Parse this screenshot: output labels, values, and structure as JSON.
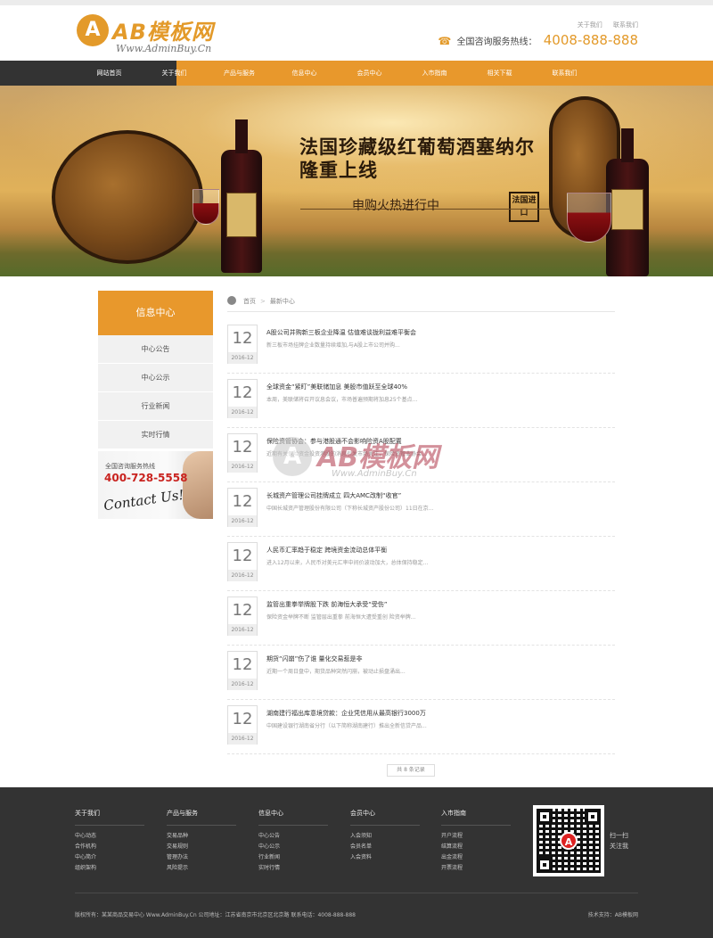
{
  "header": {
    "logo_mark": "A",
    "logo_text": "AB模板网",
    "logo_sub": "Www.AdminBuy.Cn",
    "top_links": [
      "关于我们",
      "联系我们"
    ],
    "hotline_label": "全国咨询服务热线：",
    "hotline_number": "4008-888-888"
  },
  "nav": {
    "items": [
      "网站首页",
      "关于我们",
      "产品与服务",
      "信息中心",
      "会员中心",
      "入市指南",
      "相关下载",
      "联系我们"
    ]
  },
  "banner": {
    "title_line1": "法国珍藏级红葡萄酒塞纳尔",
    "title_line2": "隆重上线",
    "subtitle": "申购火热进行中",
    "stamp": "法国进口"
  },
  "sidebar": {
    "title": "信息中心",
    "items": [
      "中心公告",
      "中心公示",
      "行业新闻",
      "实时行情"
    ],
    "contact_label": "全国咨询服务热线",
    "contact_number": "400-728-5558",
    "contact_sig": "Contact Us!"
  },
  "breadcrumb": {
    "home": "首页",
    "current": "最新中心"
  },
  "news": [
    {
      "day": "12",
      "ym": "2016-12",
      "title": "A股公司并购新三板企业降温 估值难谈拢利益难平衡会",
      "desc": "新三板市场挂牌企业数量持续增加,与A股上市公司并购..."
    },
    {
      "day": "12",
      "ym": "2016-12",
      "title": "全球资金“紧盯”美联储加息 美股市值跃至全球40%",
      "desc": "本周，美联储将召开议息会议，市场普遍预期将加息25个基点..."
    },
    {
      "day": "12",
      "ym": "2016-12",
      "title": "保险资管协会：参与港股通不会影响险资A股配置",
      "desc": "近期有关保险资金投资港股的消息引发市场关注，保险资管业协会..."
    },
    {
      "day": "12",
      "ym": "2016-12",
      "title": "长城资产管理公司挂牌成立 四大AMC改制“收官”",
      "desc": "中国长城资产管理股份有限公司（下称长城资产股份公司）11日在京..."
    },
    {
      "day": "12",
      "ym": "2016-12",
      "title": "人民币汇率趋于稳定 跨境资金流动总体平衡",
      "desc": "进入12月以来，人民币对美元汇率中间价波动加大，总体保持稳定..."
    },
    {
      "day": "12",
      "ym": "2016-12",
      "title": "监管出重拳举牌股下跌 前海恒大承受“受伤”",
      "desc": "保险资金举牌不断 监管层出重拳 前海恒大遭受重创 险资举牌..."
    },
    {
      "day": "12",
      "ym": "2016-12",
      "title": "期货“闪崩”伤了谁 量化交易惹是非",
      "desc": "近期一个周日盘中，期货品种突然闪崩，被动止损盘涌出..."
    },
    {
      "day": "12",
      "ym": "2016-12",
      "title": "湖南建行福出库意境贷款：企业凭信用从最高银行3000万",
      "desc": "中国建设银行湖南省分行（以下简称湖南建行）推出全新信贷产品..."
    }
  ],
  "pager": "共 8 条记录",
  "watermark": {
    "mark": "A",
    "text": "AB模板网",
    "sub": "Www.AdminBuy.Cn"
  },
  "footer": {
    "columns": [
      {
        "title": "关于我们",
        "links": [
          "中心动态",
          "合作机构",
          "中心简介",
          "组织架构"
        ]
      },
      {
        "title": "产品与服务",
        "links": [
          "交易品种",
          "交易规则",
          "管理办法",
          "风险提示"
        ]
      },
      {
        "title": "信息中心",
        "links": [
          "中心公告",
          "中心公示",
          "行业新闻",
          "实时行情"
        ]
      },
      {
        "title": "会员中心",
        "links": [
          "入会须知",
          "会员名单",
          "入会资料"
        ]
      },
      {
        "title": "入市指南",
        "links": [
          "开户流程",
          "结算流程",
          "出金流程",
          "开票流程"
        ]
      }
    ],
    "qr_text_1": "扫一扫",
    "qr_text_2": "关注我",
    "copyright": "版权所有：某某商品交易中心 Www.AdminBuy.Cn   公司地址：江苏省南京市北京区北京路   联系电话：4008-888-888",
    "tech": "技术支持：AB模板网"
  }
}
